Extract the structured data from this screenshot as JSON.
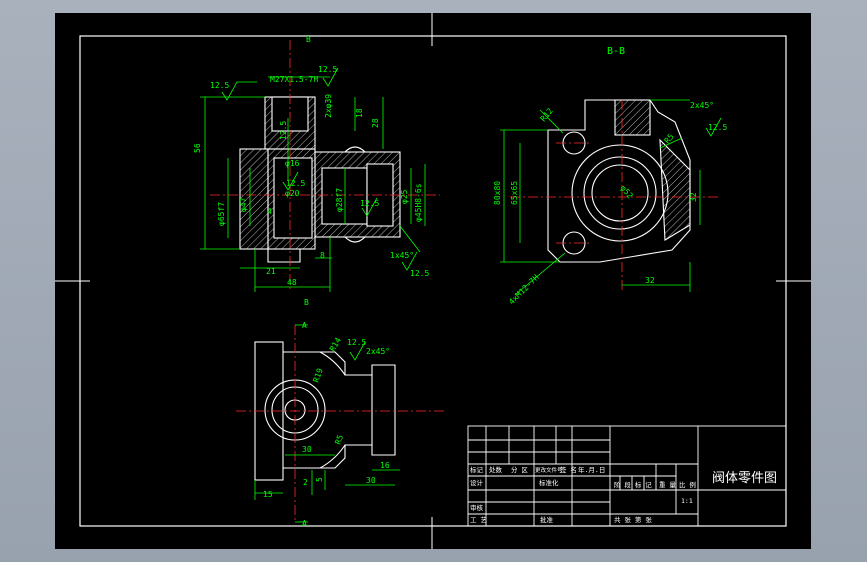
{
  "colors": {
    "background": "#000000",
    "border": "#ffffff",
    "geometry": "#ffffff",
    "dimension": "#00ff00",
    "centerline": "#ff2a2a",
    "hatch": "#ffffff",
    "viewport_outer": "#a4acb8"
  },
  "views": {
    "section_bb_title": "B-B",
    "b_marker_top": "B",
    "b_marker_mid": "B",
    "a_marker_top": "A",
    "a_marker_bottom": "A"
  },
  "dims_front": {
    "ra_left": "12.5",
    "thread_top": "M27X1.5-7H",
    "ra_top": "12.5",
    "chamfer_top": "2xφ39",
    "d18": "18",
    "d28": "28",
    "d56": "56",
    "d12_5": "12.5",
    "phi16": "φ16",
    "phi20": "φ20",
    "ra_mid": "12.5",
    "phi65f7": "φ65f7",
    "phi47": "φ47",
    "d4": "4",
    "phi28f7": "φ28f7",
    "phi25": "φ25",
    "phi45h8": "φ45H8-6s",
    "ra_mid2": "12.5",
    "chamfer_1x45": "1x45°",
    "ra_right": "12.5",
    "d21": "21",
    "d8": "8",
    "d48": "48"
  },
  "dims_section": {
    "r12": "R12",
    "chamfer_2x45": "2x45°",
    "ra_r": "12.5",
    "r5": "R5",
    "d80x80": "80x80",
    "d65x65": "65x65",
    "phi52": "φ52",
    "d32_right": "32",
    "d32_bottom": "32",
    "holes": "4xM12-7H"
  },
  "dims_bottom": {
    "r14": "R14",
    "ra": "12.5",
    "chamfer_2x45": "2x45°",
    "r19": "R19",
    "d30": "30",
    "r5": "R5",
    "d5": "5",
    "d2": "2",
    "d15": "15",
    "d30b": "30",
    "d16": "16"
  },
  "title_block": {
    "part_name": "阀体零件图",
    "row_labels": [
      "标记",
      "处数",
      "分 区",
      "更改文件号",
      "签 名",
      "年.月.日"
    ],
    "design": "设计",
    "standardize": "标准化",
    "stage_mark": "阶 段 标 记",
    "weight": "重 量",
    "scale": "比 例",
    "scale_value": "1:1",
    "review": "审核",
    "process": "工 艺",
    "approve": "批准",
    "sheets": "共   张   第   张"
  }
}
